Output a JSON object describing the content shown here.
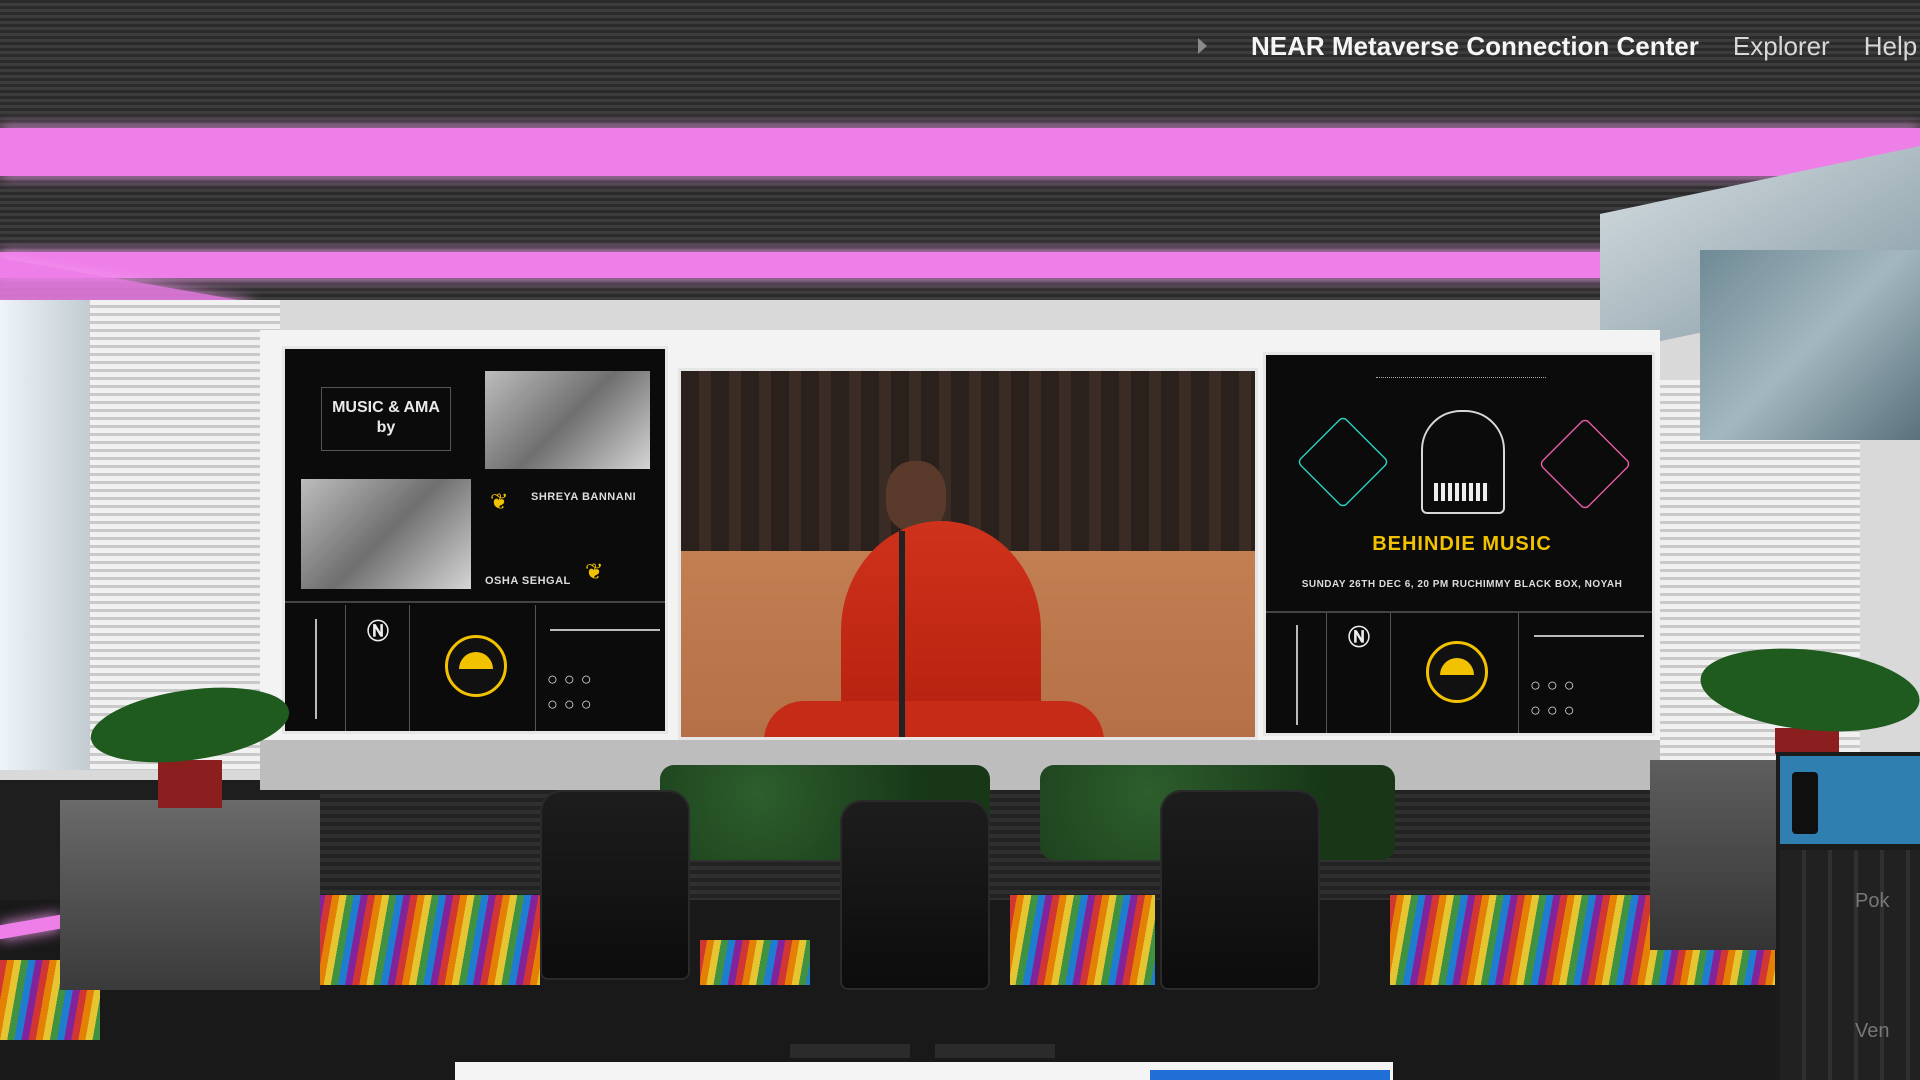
{
  "hud": {
    "title": "NEAR Metaverse Connection Center",
    "explorer": "Explorer",
    "help": "Help"
  },
  "left_poster": {
    "heading": "MUSIC & AMA by",
    "artist_1": "SHREYA BANNANI",
    "artist_2": "OSHA SEHGAL"
  },
  "right_poster": {
    "brand": "BEHINDIE MUSIC",
    "details": "SUNDAY 26TH DEC 6, 20 PM RUCHIMMY BLACK BOX, NOYAH"
  },
  "side_sign": {
    "line1": "Pok",
    "line2": "Ven"
  },
  "icons": {
    "hud_chevron": "chevron-right-icon",
    "logo": "behindie-fan-logo-icon"
  },
  "colors": {
    "neon": "#ee7ee8",
    "accent": "#f2c200"
  }
}
